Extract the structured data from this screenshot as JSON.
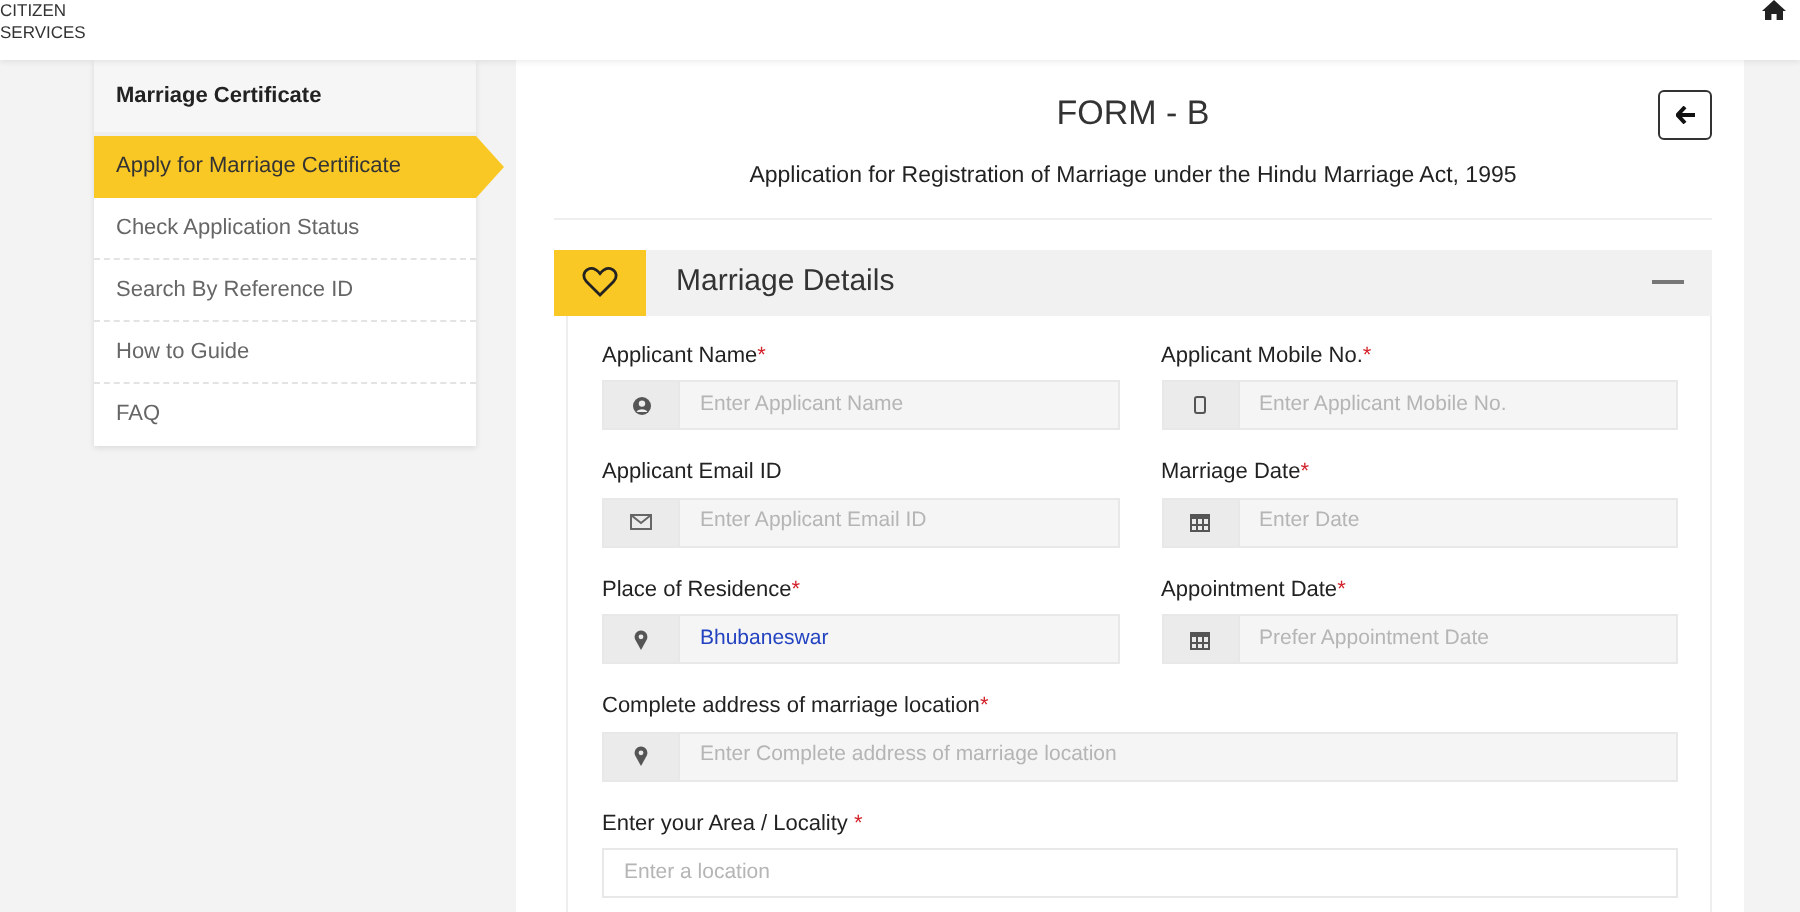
{
  "header": {
    "brand_lines": [
      "CITIZEN",
      "SERVICES"
    ]
  },
  "sidebar": {
    "title": "Marriage Certificate",
    "items": [
      {
        "label": "Apply for Marriage Certificate",
        "selected": true
      },
      {
        "label": "Check Application Status",
        "selected": false
      },
      {
        "label": "Search By Reference ID",
        "selected": false
      },
      {
        "label": "How to Guide",
        "selected": false
      },
      {
        "label": "FAQ",
        "selected": false
      }
    ]
  },
  "form": {
    "title": "FORM - B",
    "subtitle": "Application for Registration of Marriage under the Hindu Marriage Act, 1995",
    "section": {
      "title": "Marriage Details",
      "expanded": true
    },
    "required_marker": "*",
    "rows": [
      [
        {
          "kind": "person",
          "label": "Applicant Name",
          "required": true,
          "placeholder": "Enter Applicant Name"
        },
        {
          "kind": "mobile",
          "label": "Applicant Mobile No.",
          "required": true,
          "placeholder": "Enter Applicant Mobile No."
        }
      ],
      [
        {
          "kind": "email",
          "label": "Applicant Email ID",
          "required": false,
          "placeholder": "Enter Applicant Email ID"
        },
        {
          "kind": "date",
          "label": "Marriage Date",
          "required": true,
          "placeholder": "Enter Date"
        }
      ],
      [
        {
          "kind": "place",
          "label": "Place of Residence",
          "required": true,
          "value": "Bhubaneswar"
        },
        {
          "kind": "date",
          "label": "Appointment Date",
          "required": true,
          "placeholder": "Prefer Appointment Date"
        }
      ],
      [
        {
          "kind": "place",
          "label": "Complete address of marriage location",
          "required": true,
          "placeholder": "Enter Complete address of marriage location"
        }
      ],
      [
        {
          "kind": "plain",
          "label": "Enter your Area / Locality ",
          "required": true,
          "placeholder": "Enter a location"
        }
      ]
    ]
  }
}
